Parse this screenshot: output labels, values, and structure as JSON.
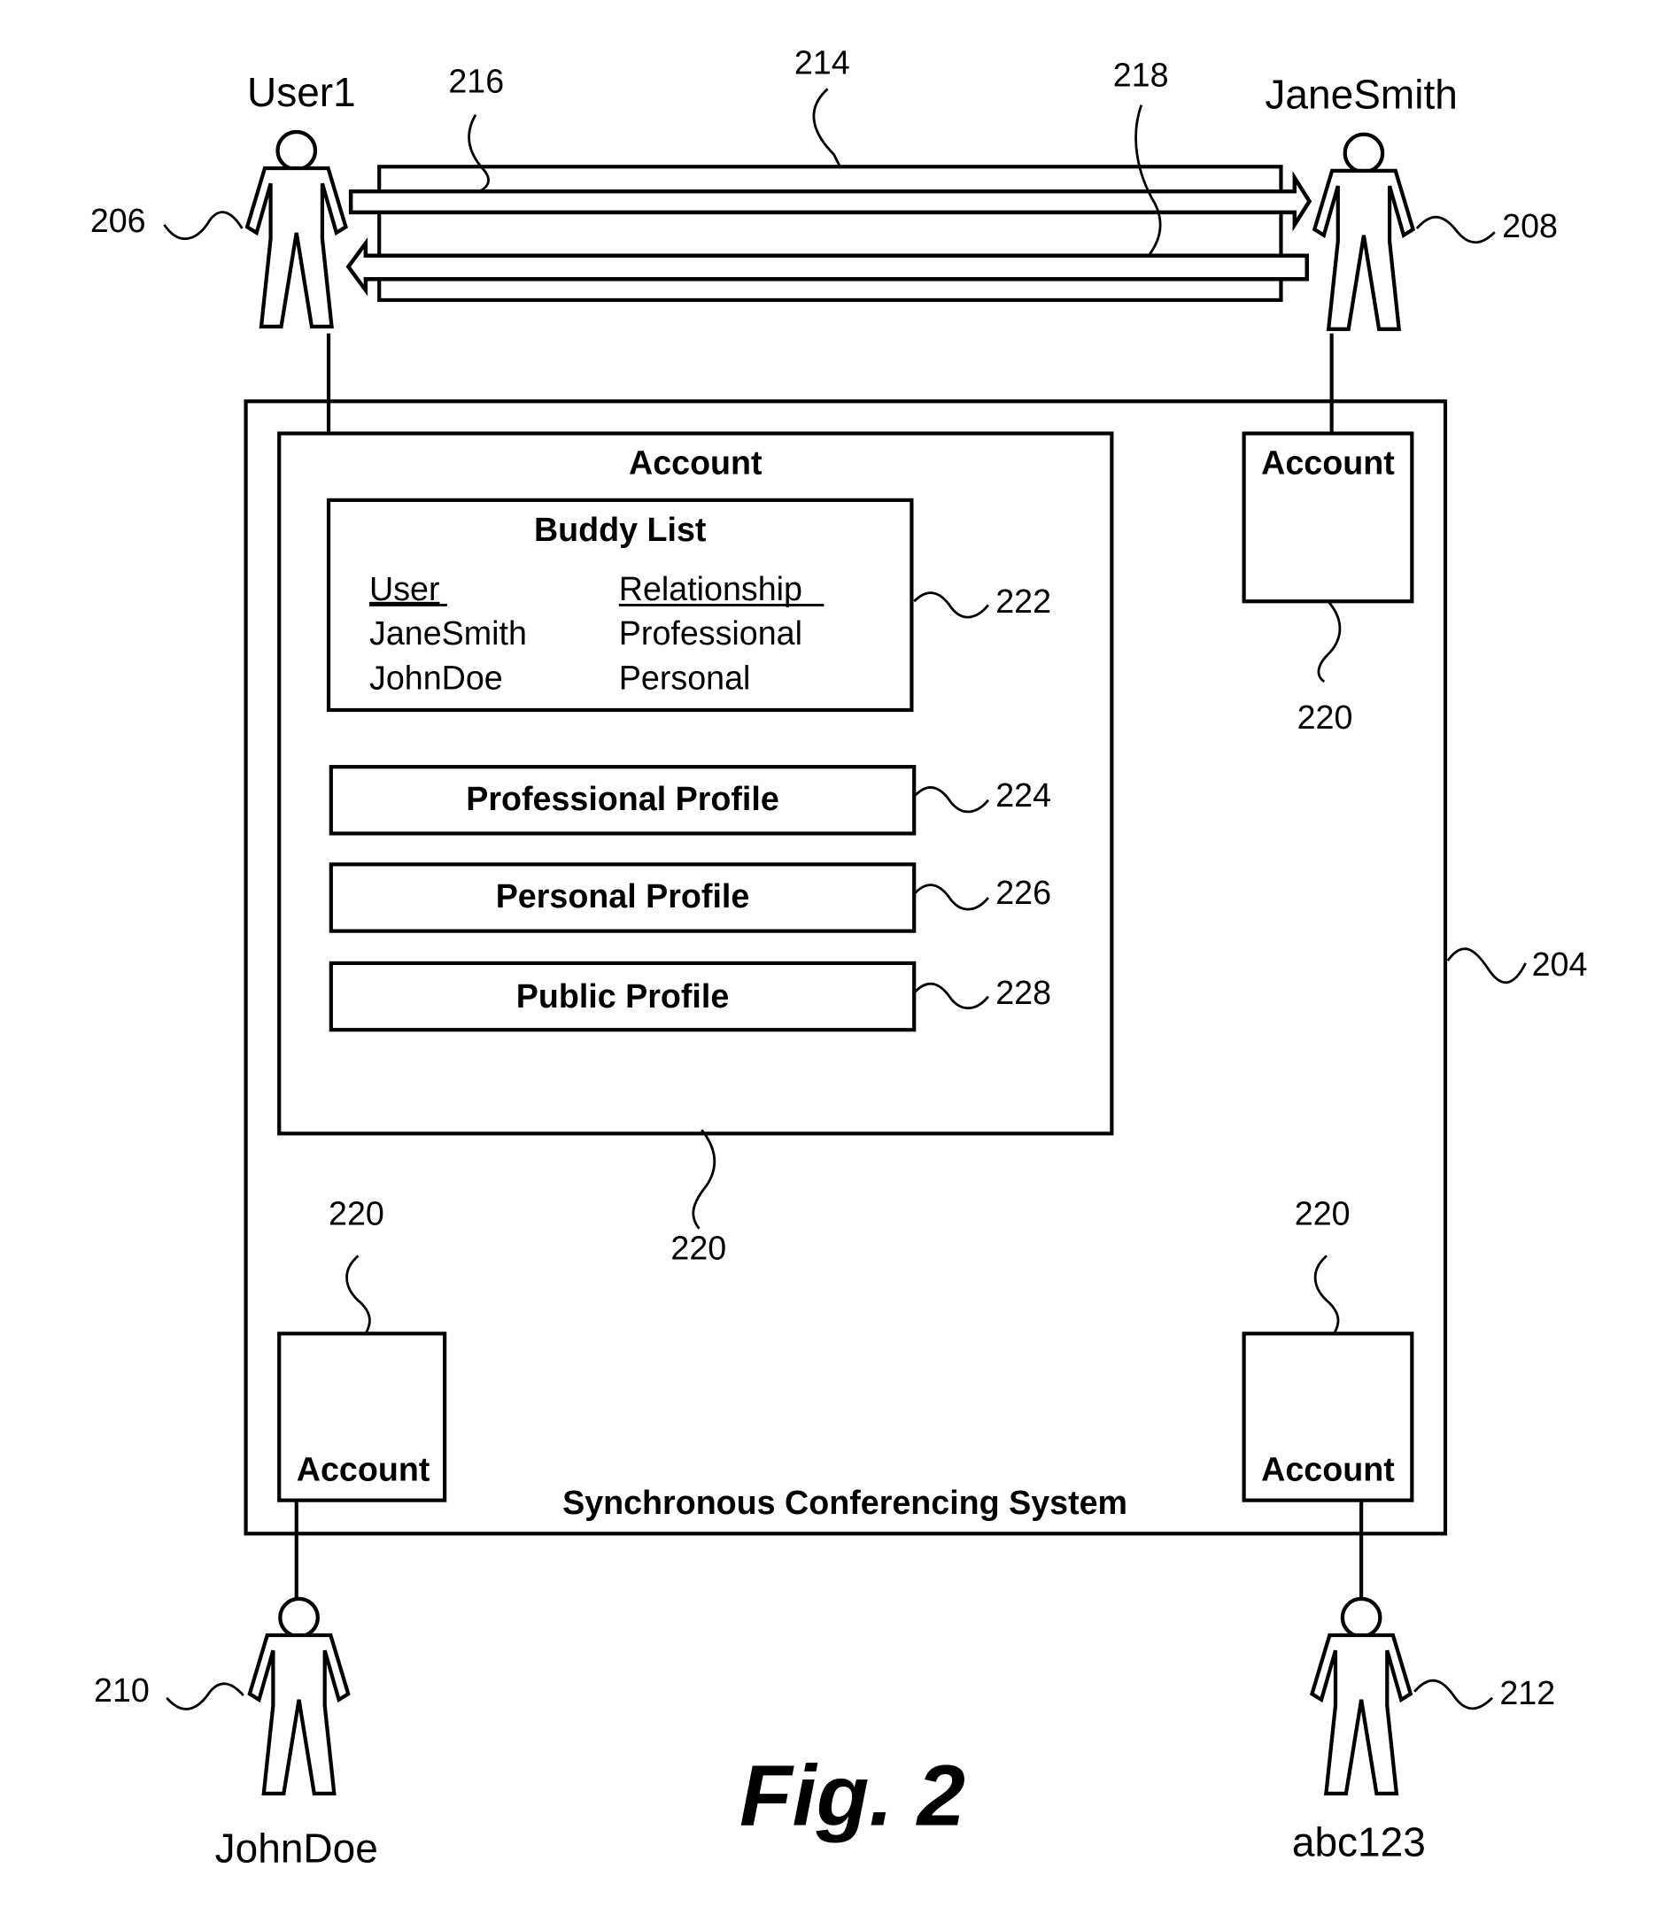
{
  "figure": {
    "caption": "Fig. 2",
    "system": {
      "label": "Synchronous Conferencing System",
      "ref": "204"
    },
    "users": [
      {
        "name": "User1",
        "ref": "206"
      },
      {
        "name": "JaneSmith",
        "ref": "208"
      },
      {
        "name": "JohnDoe",
        "ref": "210"
      },
      {
        "name": "abc123",
        "ref": "212"
      }
    ],
    "communication": {
      "channel_ref": "214",
      "outgoing_ref": "216",
      "incoming_ref": "218"
    },
    "accounts": {
      "label": "Account",
      "ref": "220",
      "main": {
        "label": "Account",
        "ref": "220",
        "buddy_list": {
          "title": "Buddy List",
          "ref": "222",
          "columns": [
            "User",
            "Relationship"
          ],
          "rows": [
            [
              "JaneSmith",
              "Professional"
            ],
            [
              "JohnDoe",
              "Personal"
            ]
          ]
        },
        "profiles": [
          {
            "label": "Professional Profile",
            "ref": "224"
          },
          {
            "label": "Personal Profile",
            "ref": "226"
          },
          {
            "label": "Public Profile",
            "ref": "228"
          }
        ]
      },
      "others": [
        {
          "label": "Account",
          "ref": "220",
          "owner": "JaneSmith"
        },
        {
          "label": "Account",
          "ref": "220",
          "owner": "JohnDoe"
        },
        {
          "label": "Account",
          "ref": "220",
          "owner": "abc123"
        }
      ]
    }
  }
}
